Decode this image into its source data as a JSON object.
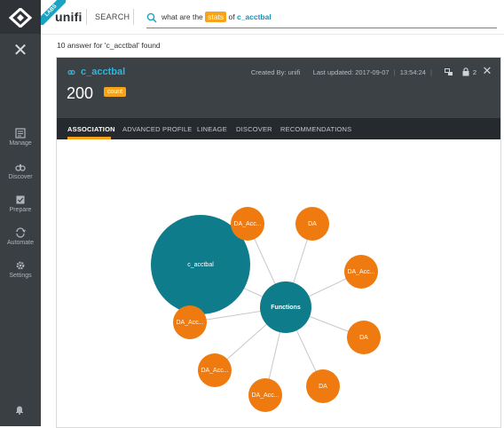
{
  "app": {
    "brand": "unifi",
    "labs_badge": "LABS",
    "nav_label": "SEARCH"
  },
  "sidebar": {
    "items": [
      {
        "label": "Manage",
        "icon": "manage-icon"
      },
      {
        "label": "Discover",
        "icon": "binoculars-icon"
      },
      {
        "label": "Prepare",
        "icon": "prepare-icon"
      },
      {
        "label": "Automate",
        "icon": "automate-icon"
      },
      {
        "label": "Settings",
        "icon": "gear-icon"
      }
    ]
  },
  "search": {
    "prefix": "what are the",
    "highlight": "stats",
    "middle": "of",
    "token": "c_acctbal"
  },
  "results_text": "10 answer for 'c_acctbal' found",
  "card": {
    "entity": "c_acctbal",
    "metric_value": "200",
    "metric_badge": "count",
    "created_by": "Created By: unifi",
    "last_updated": "Last updated: 2017-09-07",
    "time": "13:54:24",
    "lock_count": "2"
  },
  "tabs": [
    {
      "label": "ASSOCIATION",
      "active": true
    },
    {
      "label": "ADVANCED PROFILE",
      "active": false
    },
    {
      "label": "LINEAGE",
      "active": false
    },
    {
      "label": "DISCOVER",
      "active": false
    },
    {
      "label": "RECOMMENDATIONS",
      "active": false
    }
  ],
  "colors": {
    "accent": "#f5a31a",
    "teal": "#0e7c8b",
    "orange_node": "#ef7b10",
    "link": "#1aa3c2"
  },
  "graph": {
    "center": {
      "label": "Functions"
    },
    "main": {
      "label": "c_acctbal"
    },
    "nodes": [
      {
        "label": "DA_Acc..."
      },
      {
        "label": "DA"
      },
      {
        "label": "DA_Acc..."
      },
      {
        "label": "DA"
      },
      {
        "label": "DA"
      },
      {
        "label": "DA_Acc..."
      },
      {
        "label": "DA_Acc..."
      },
      {
        "label": "DA_Acc..."
      }
    ]
  }
}
